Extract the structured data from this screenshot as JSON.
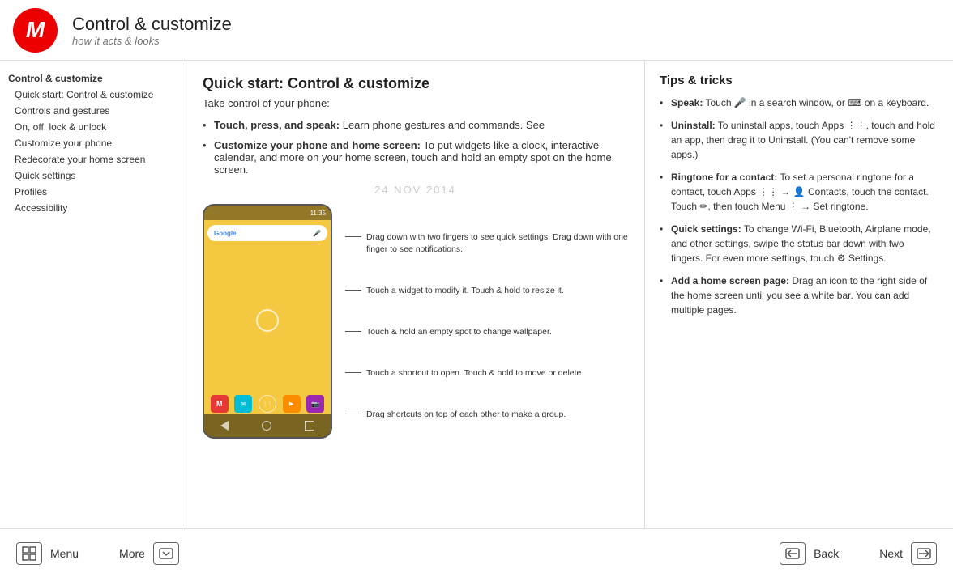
{
  "header": {
    "title": "Control & customize",
    "subtitle": "how it acts & looks",
    "logo_alt": "Motorola logo"
  },
  "sidebar": {
    "items": [
      {
        "id": "control-customize",
        "label": "Control & customize",
        "bold": true,
        "indent": false
      },
      {
        "id": "quick-start",
        "label": "Quick start: Control & customize",
        "bold": false,
        "indent": true
      },
      {
        "id": "controls-gestures",
        "label": "Controls and gestures",
        "bold": false,
        "indent": true
      },
      {
        "id": "on-off-lock",
        "label": "On, off, lock & unlock",
        "bold": false,
        "indent": true
      },
      {
        "id": "customize-phone",
        "label": "Customize your phone",
        "bold": false,
        "indent": true
      },
      {
        "id": "redecorate",
        "label": "Redecorate your home screen",
        "bold": false,
        "indent": true
      },
      {
        "id": "quick-settings",
        "label": "Quick settings",
        "bold": false,
        "indent": true
      },
      {
        "id": "profiles",
        "label": "Profiles",
        "bold": false,
        "indent": true
      },
      {
        "id": "accessibility",
        "label": "Accessibility",
        "bold": false,
        "indent": true
      }
    ]
  },
  "main": {
    "title": "Quick start: Control & customize",
    "subtitle": "Take control of your phone:",
    "bullets": [
      {
        "bold": "Touch, press, and speak:",
        "text": " Learn phone gestures and commands. See"
      },
      {
        "bold": "Customize your phone and home screen:",
        "text": " To put widgets like a clock, interactive calendar, and more on your home screen, touch and hold an empty spot on the home screen."
      }
    ],
    "date_watermark": "24 NOV 2014"
  },
  "phone_callouts": [
    {
      "id": "callout-1",
      "text": "Drag down with two fingers to see quick settings. Drag down with one finger to see notifications."
    },
    {
      "id": "callout-2",
      "text": "Touch a widget to modify it. Touch & hold to resize it."
    },
    {
      "id": "callout-3",
      "text": "Touch & hold an empty spot to change wallpaper."
    },
    {
      "id": "callout-4",
      "text": "Touch a shortcut to open. Touch & hold to move or delete."
    },
    {
      "id": "callout-5",
      "text": "Drag shortcuts on top of each other to make a group."
    }
  ],
  "tips": {
    "heading": "Tips & tricks",
    "items": [
      {
        "bold": "Speak:",
        "text": " Touch 🎤 in a search window, or ⌨ on a keyboard."
      },
      {
        "bold": "Uninstall:",
        "text": " To uninstall apps, touch Apps ⋮⋮, touch and hold an app, then drag it to Uninstall. (You can't remove some apps.)"
      },
      {
        "bold": "Ringtone for a contact:",
        "text": " To set a personal ringtone for a contact, touch Apps ⋮⋮ → 👤 Contacts, touch the contact. Touch ✏, then touch Menu ⋮ → Set ringtone."
      },
      {
        "bold": "Quick settings:",
        "text": " To change Wi-Fi, Bluetooth, Airplane mode, and other settings, swipe the status bar down with two fingers. For even more settings, touch ⚙ Settings."
      },
      {
        "bold": "Add a home screen page:",
        "text": " Drag an icon to the right side of the home screen until you see a white bar. You can add multiple pages."
      }
    ]
  },
  "footer": {
    "menu_label": "Menu",
    "more_label": "More",
    "back_label": "Back",
    "next_label": "Next",
    "menu_icon": "⊞",
    "more_icon": "▽",
    "back_icon": "<<",
    "next_icon": ">>"
  }
}
